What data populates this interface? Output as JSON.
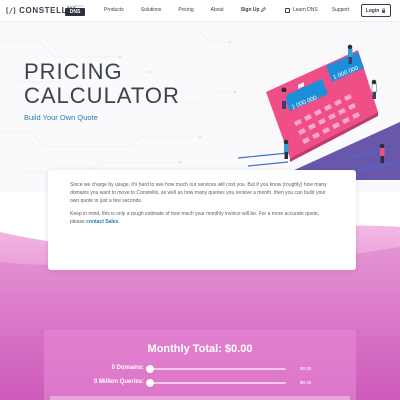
{
  "brand": {
    "logo_mark": "[/]",
    "name": "CONSTELLIX",
    "partner_byline": "a product of",
    "partner_name": "DNS"
  },
  "nav": {
    "items": [
      "Products",
      "Solutions",
      "Pricing",
      "About"
    ],
    "signup_label": "Sign Up",
    "learn_dns_label": "Learn DNS",
    "support_label": "Support",
    "login_label": "Login"
  },
  "hero": {
    "title_line1": "PRICING",
    "title_line2": "CALCULATOR",
    "subtitle": "Build Your Own Quote",
    "calculator_display": "1 000 000"
  },
  "intro": {
    "paragraph1": "Since we charge by usage, it's hard to see how much our services will cost you. But if you know (roughly) how many domains you want to move to Constellix, as well as how many queries you receive a month, then you can build your own quote in just a few seconds.",
    "paragraph2_text": "Keep in mind, this is only a rough estimate of how much your monthly invoice will be. For a more accurate quote, please ",
    "contact_link": "contact Sales",
    "paragraph2_end": "."
  },
  "calculator": {
    "title": "Monthly Total: $0.00",
    "rows": [
      {
        "label": "0 Domains:",
        "price": "$0.00",
        "value": 0
      },
      {
        "label": "0 Million Queries:",
        "price": "$0.00",
        "value": 0
      }
    ]
  },
  "colors": {
    "accent_blue": "#1f7fa8",
    "gradient_top": "#f3b9e4",
    "gradient_bottom": "#c955b8",
    "calculator_pink": "#ef4f86",
    "iso_purple": "#4f3a9e"
  },
  "icons": [
    "pencil-icon",
    "book-icon",
    "lock-icon"
  ]
}
